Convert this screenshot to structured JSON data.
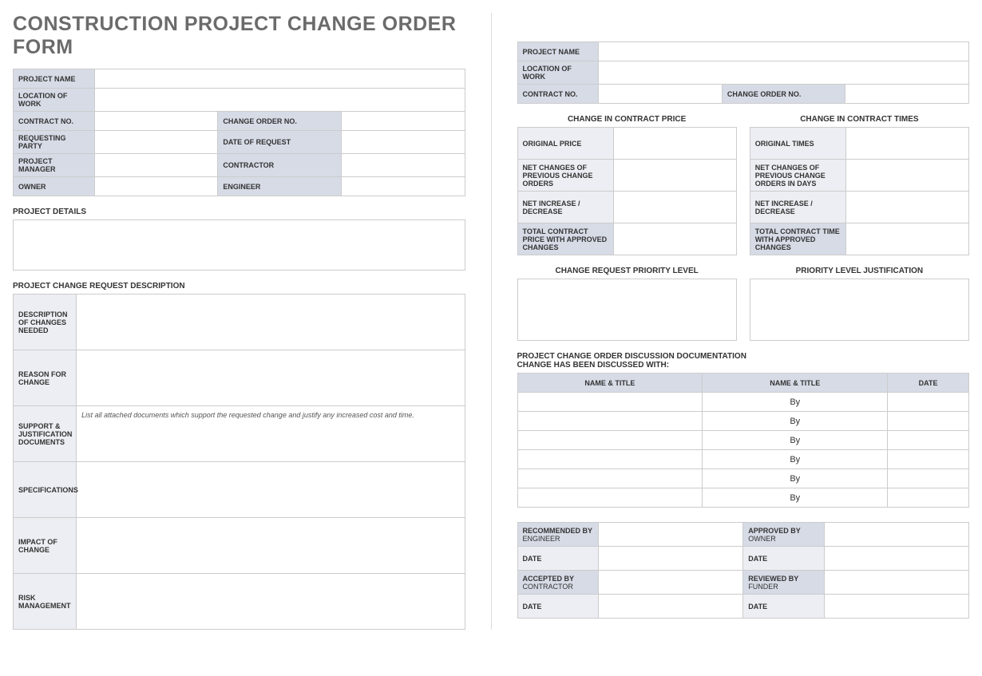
{
  "title": "CONSTRUCTION PROJECT CHANGE ORDER FORM",
  "left": {
    "header": {
      "projectName": "PROJECT NAME",
      "locationOfWork": "LOCATION OF WORK",
      "contractNo": "CONTRACT NO.",
      "changeOrderNo": "CHANGE ORDER NO.",
      "requestingParty": "REQUESTING PARTY",
      "dateOfRequest": "DATE OF REQUEST",
      "projectManager": "PROJECT MANAGER",
      "contractor": "CONTRACTOR",
      "owner": "OWNER",
      "engineer": "ENGINEER"
    },
    "projectDetails": "PROJECT DETAILS",
    "changeReqDesc": "PROJECT CHANGE REQUEST DESCRIPTION",
    "descRows": {
      "descChanges": "DESCRIPTION OF CHANGES NEEDED",
      "reason": "REASON FOR CHANGE",
      "support": "SUPPORT & JUSTIFICATION DOCUMENTS",
      "supportHint": "List all attached documents which support the requested change and justify any increased cost and time.",
      "specifications": "SPECIFICATIONS",
      "impact": "IMPACT OF CHANGE",
      "risk": "RISK MANAGEMENT"
    }
  },
  "right": {
    "header": {
      "projectName": "PROJECT NAME",
      "locationOfWork": "LOCATION OF WORK",
      "contractNo": "CONTRACT NO.",
      "changeOrderNo": "CHANGE ORDER NO."
    },
    "priceTitle": "CHANGE IN CONTRACT PRICE",
    "timesTitle": "CHANGE IN CONTRACT TIMES",
    "price": {
      "original": "ORIGINAL PRICE",
      "netPrev": "NET CHANGES OF PREVIOUS CHANGE ORDERS",
      "netIncDec": "NET INCREASE / DECREASE",
      "total": "TOTAL CONTRACT PRICE WITH APPROVED CHANGES"
    },
    "times": {
      "original": "ORIGINAL TIMES",
      "netPrev": "NET CHANGES OF PREVIOUS CHANGE ORDERS IN DAYS",
      "netIncDec": "NET INCREASE / DECREASE",
      "total": "TOTAL CONTRACT TIME WITH APPROVED CHANGES"
    },
    "priorityLevel": "CHANGE REQUEST PRIORITY LEVEL",
    "priorityJustification": "PRIORITY LEVEL JUSTIFICATION",
    "discussionTitle1": "PROJECT CHANGE ORDER DISCUSSION DOCUMENTATION",
    "discussionTitle2": "CHANGE HAS BEEN DISCUSSED WITH:",
    "discussionHeaders": {
      "name1": "NAME & TITLE",
      "name2": "NAME & TITLE",
      "date": "DATE"
    },
    "byText": "By",
    "approval": {
      "recommendedBy": "RECOMMENDED BY",
      "engineer": "ENGINEER",
      "approvedBy": "APPROVED BY",
      "owner": "OWNER",
      "acceptedBy": "ACCEPTED BY",
      "contractor": "CONTRACTOR",
      "reviewedBy": "REVIEWED BY",
      "funder": "FUNDER",
      "date": "DATE"
    }
  }
}
